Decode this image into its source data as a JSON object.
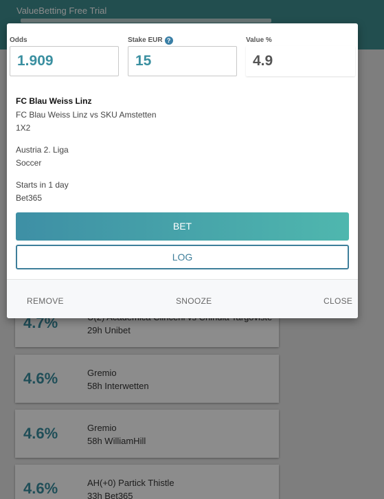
{
  "app": {
    "title": "ValueBetting Free Trial"
  },
  "background_bets": [
    {
      "value": "4.7%",
      "name": "U(2) Academica Clinceni vs Chindia Targoviste",
      "meta": "29h Unibet"
    },
    {
      "value": "4.6%",
      "name": "Gremio",
      "meta": "58h Interwetten"
    },
    {
      "value": "4.6%",
      "name": "Gremio",
      "meta": "58h WilliamHill"
    },
    {
      "value": "4.6%",
      "name": "AH(+0) Partick Thistle",
      "meta": "33h Bet365"
    }
  ],
  "modal": {
    "odds": {
      "label": "Odds",
      "value": "1.909"
    },
    "stake": {
      "label": "Stake EUR",
      "value": "15",
      "help_icon": "help-icon"
    },
    "value_pct": {
      "label": "Value %",
      "value": "4.9"
    },
    "selection": "FC Blau Weiss Linz",
    "event": "FC Blau Weiss Linz vs SKU Amstetten",
    "market": "1X2",
    "league": "Austria 2. Liga",
    "sport": "Soccer",
    "starts": "Starts in 1 day",
    "bookmaker": "Bet365",
    "bet_label": "BET",
    "log_label": "LOG",
    "footer": {
      "remove": "REMOVE",
      "snooze": "SNOOZE",
      "close": "CLOSE"
    }
  },
  "colors": {
    "accent": "#3a8fa0",
    "bet_gradient_start": "#3e8fa5",
    "bet_gradient_end": "#4fb7ae",
    "header": "#3f8f90"
  }
}
